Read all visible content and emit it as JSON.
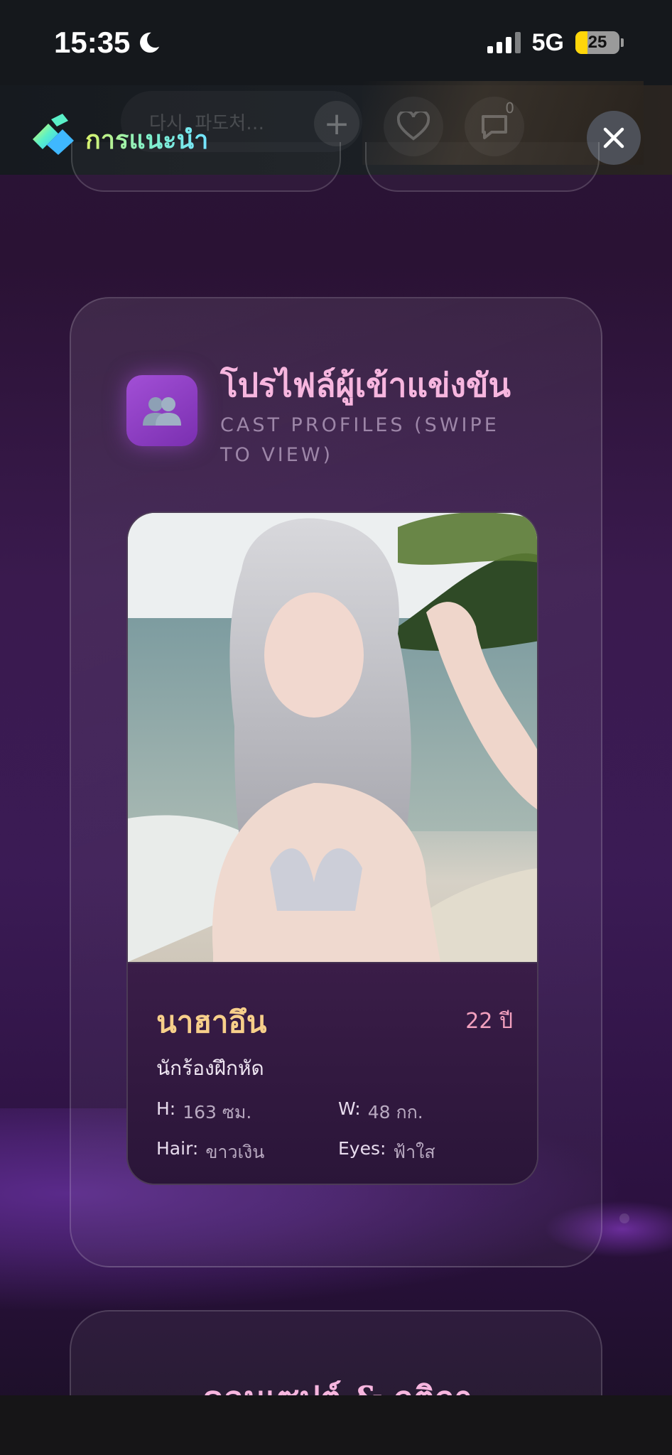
{
  "status_bar": {
    "time": "15:35",
    "network": "5G",
    "battery": "25"
  },
  "header": {
    "title": "การแนะนำ",
    "ghost_text": "다시, 파도처…",
    "comment_count": "0"
  },
  "section": {
    "title": "โปรไฟล์ผู้เข้าแข่งขัน",
    "subtitle": "CAST PROFILES (SWIPE TO VIEW)"
  },
  "profile": {
    "name": "นาฮาอึน",
    "age": "22 ปี",
    "role": "นักร้องฝึกหัด",
    "height_label": "H:",
    "height_value": "163 ซม.",
    "weight_label": "W:",
    "weight_value": "48 กก.",
    "hair_label": "Hair:",
    "hair_value": "ขาวเงิน",
    "eyes_label": "Eyes:",
    "eyes_value": "ฟ้าใส"
  },
  "next_section": {
    "title": "คอนเซปต์ & กติกา"
  },
  "colors": {
    "accent_pink": "#f7b6df",
    "name_gold": "#f7cf8a",
    "icon_purple": "#a24fd6"
  }
}
